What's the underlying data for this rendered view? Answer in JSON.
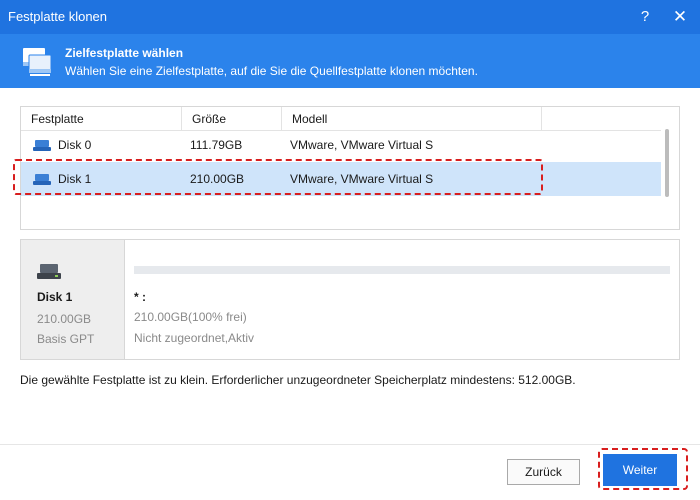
{
  "window": {
    "title": "Festplatte klonen",
    "help_glyph": "?",
    "close_glyph": "✕"
  },
  "header": {
    "title": "Zielfestplatte wählen",
    "subtitle": "Wählen Sie eine Zielfestplatte, auf die Sie die Quellfestplatte klonen möchten."
  },
  "table": {
    "columns": [
      "Festplatte",
      "Größe",
      "Modell"
    ],
    "rows": [
      {
        "name": "Disk 0",
        "size": "111.79GB",
        "model": "VMware, VMware Virtual S",
        "selected": false
      },
      {
        "name": "Disk 1",
        "size": "210.00GB",
        "model": "VMware, VMware Virtual S",
        "selected": true
      }
    ]
  },
  "detail": {
    "disk_name": "Disk 1",
    "disk_size": "210.00GB",
    "disk_type": "Basis GPT",
    "partition_label": "* :",
    "partition_info": "210.00GB(100% frei)",
    "partition_status": "Nicht zugeordnet,Aktiv"
  },
  "message": "Die gewählte Festplatte ist zu klein. Erforderlicher unzugeordneter Speicherplatz mindestens: 512.00GB.",
  "buttons": {
    "back": "Zurück",
    "next": "Weiter"
  },
  "colors": {
    "titlebar": "#1f73e0",
    "header": "#2b83eb",
    "selected_row": "#cfe4fa",
    "highlight": "#d81e1e"
  }
}
